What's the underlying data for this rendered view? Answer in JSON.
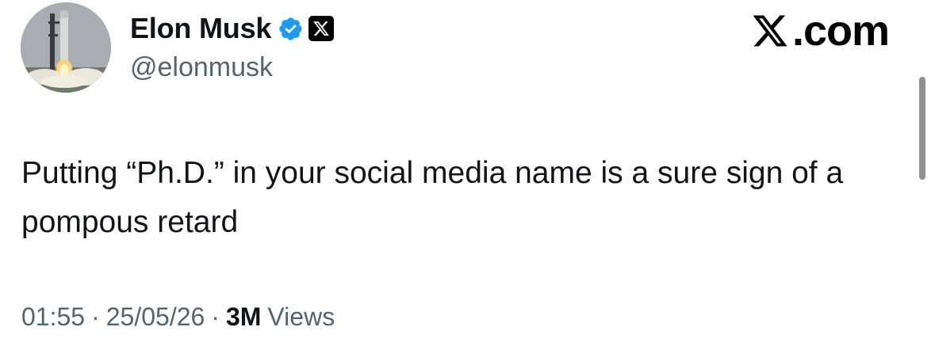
{
  "author": {
    "display_name": "Elon Musk",
    "handle": "@elonmusk",
    "verified_icon": "verified-badge-icon",
    "affiliate_icon": "x-logo-icon",
    "verified_color": "#1d9bf0"
  },
  "brand": {
    "label": ".com",
    "logo_icon": "x-logo-icon"
  },
  "tweet": {
    "text": "Putting “Ph.D.” in your social media name is a sure sign of a pompous retard",
    "time": "01:55",
    "separator": "·",
    "date": "25/05/26",
    "views_count": "3M",
    "views_label": "Views"
  },
  "colors": {
    "text": "#0f1419",
    "secondary": "#536471",
    "scrollbar": "#8e8e93"
  }
}
